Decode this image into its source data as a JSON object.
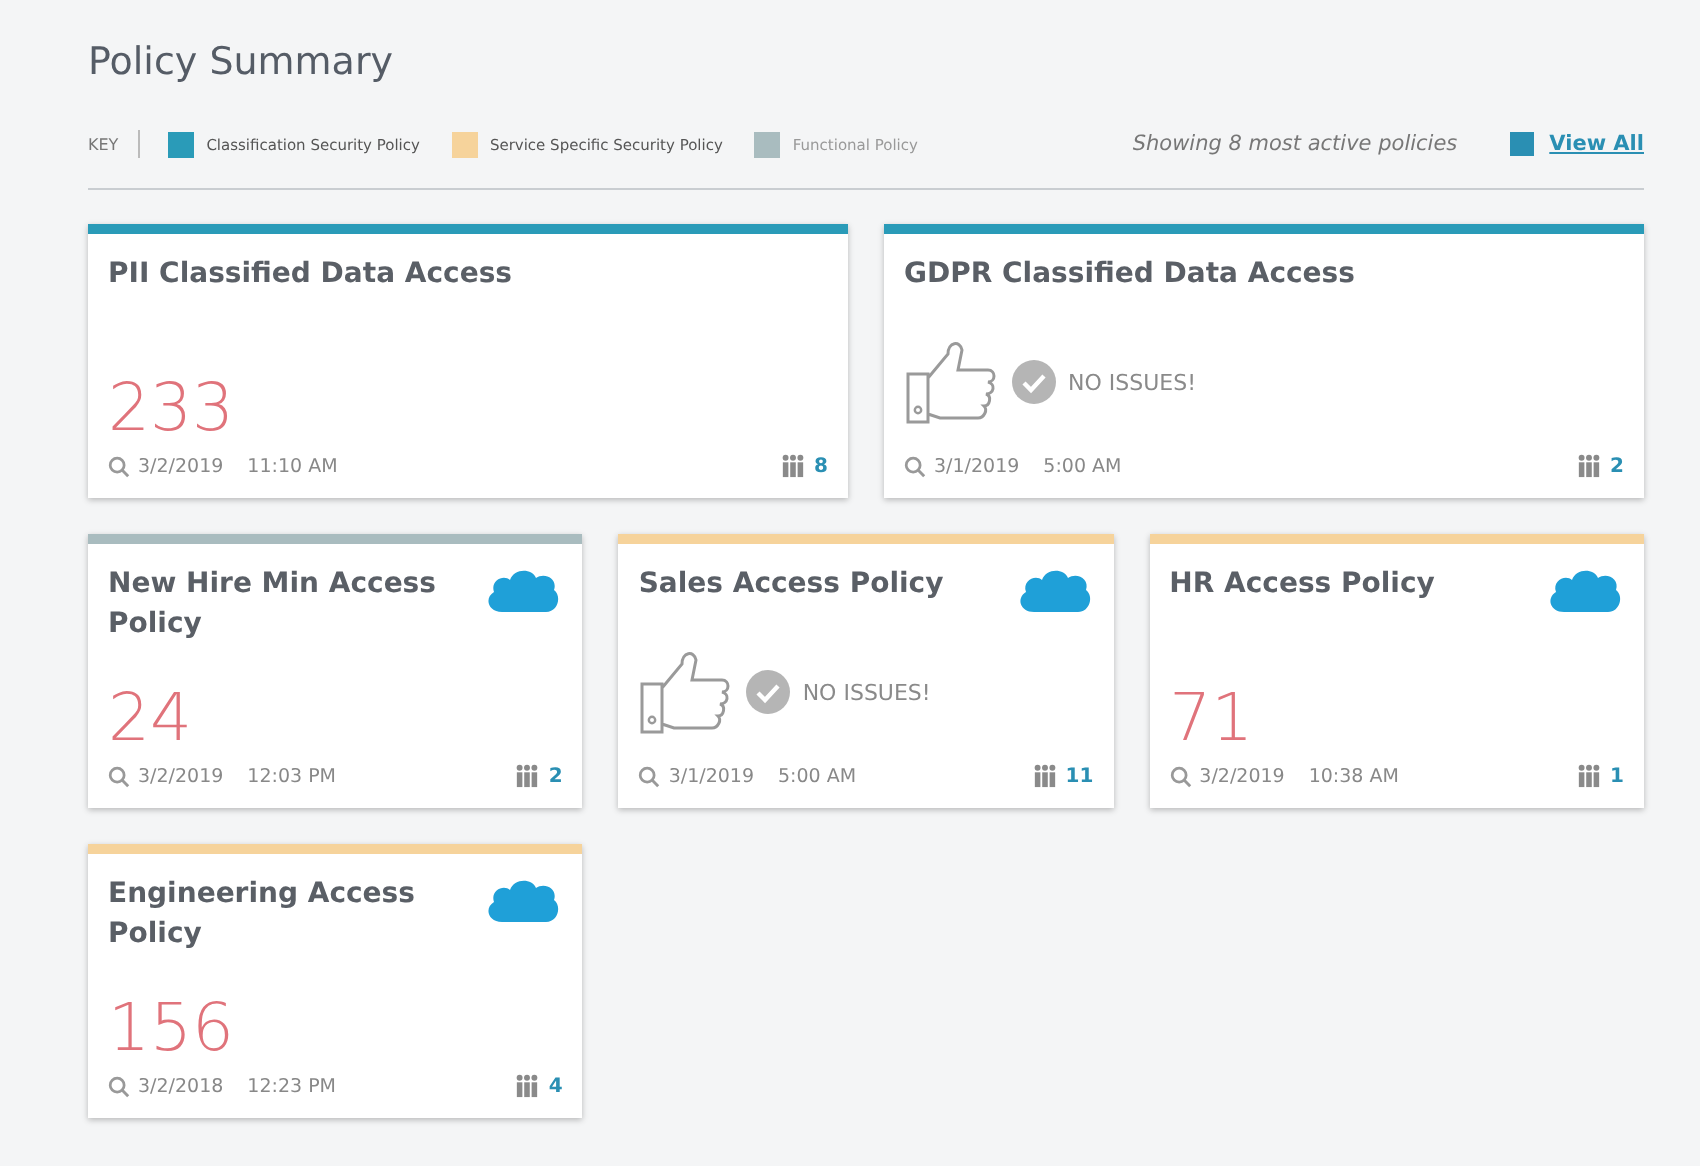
{
  "title": "Policy Summary",
  "key": {
    "label": "KEY",
    "items": [
      {
        "label": "Classification Security Policy",
        "color": "#2a9bb8"
      },
      {
        "label": "Service Specific Security Policy",
        "color": "#f6d39b"
      },
      {
        "label": "Functional Policy",
        "color": "#a9bcbf"
      }
    ]
  },
  "showing": "Showing 8 most active policies",
  "view_all": "View All",
  "rows": [
    {
      "cards": [
        {
          "title": "PII Classified Data Access",
          "color": "#2a9bb8",
          "cloud_badge": false,
          "kind": "count",
          "value": "233",
          "date": "3/2/2019",
          "time": "11:10 AM",
          "users": "8"
        },
        {
          "title": "GDPR Classified Data Access",
          "color": "#2a9bb8",
          "cloud_badge": false,
          "kind": "ok",
          "value": "NO ISSUES!",
          "date": "3/1/2019",
          "time": "5:00 AM",
          "users": "2"
        }
      ]
    },
    {
      "cards": [
        {
          "title": "New Hire Min Access Policy",
          "color": "#a9bcbf",
          "cloud_badge": true,
          "kind": "count",
          "value": "24",
          "date": "3/2/2019",
          "time": "12:03 PM",
          "users": "2"
        },
        {
          "title": "Sales Access Policy",
          "color": "#f6d39b",
          "cloud_badge": true,
          "kind": "ok",
          "value": "NO ISSUES!",
          "date": "3/1/2019",
          "time": "5:00 AM",
          "users": "11"
        },
        {
          "title": "HR Access Policy",
          "color": "#f6d39b",
          "cloud_badge": true,
          "kind": "count",
          "value": "71",
          "date": "3/2/2019",
          "time": "10:38 AM",
          "users": "1"
        }
      ]
    },
    {
      "cards": [
        {
          "title": "Engineering Access Policy",
          "color": "#f6d39b",
          "cloud_badge": true,
          "kind": "count",
          "value": "156",
          "date": "3/2/2018",
          "time": "12:23 PM",
          "users": "4"
        }
      ]
    }
  ]
}
